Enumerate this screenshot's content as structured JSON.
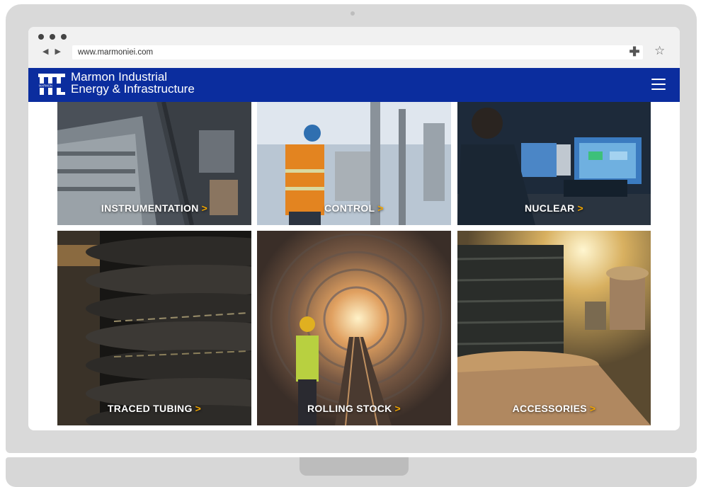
{
  "browser": {
    "url": "www.marmoniei.com",
    "nav_arrows": "◀ ▶",
    "plus_glyph": "✚",
    "star_glyph": "☆"
  },
  "header": {
    "brand_line1": "Marmon Industrial",
    "brand_line2": "Energy & Infrastructure",
    "logo_text": "MARMON",
    "brand_color": "#0b2d9e"
  },
  "tiles": [
    {
      "label": "INSTRUMENTATION",
      "arrow": ">"
    },
    {
      "label": "CONTROL",
      "arrow": ">"
    },
    {
      "label": "NUCLEAR",
      "arrow": ">"
    },
    {
      "label": "TRACED TUBING",
      "arrow": ">"
    },
    {
      "label": "ROLLING STOCK",
      "arrow": ">"
    },
    {
      "label": "ACCESSORIES",
      "arrow": ">"
    }
  ],
  "accent_color": "#f0a500"
}
